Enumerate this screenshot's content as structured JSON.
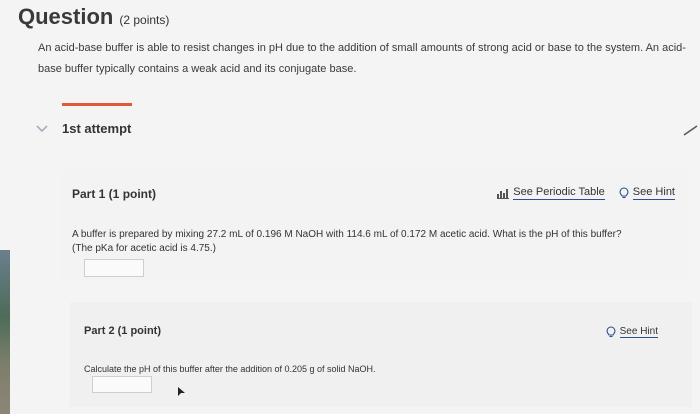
{
  "question": {
    "title": "Question",
    "points": "(2 points)",
    "intro": "An acid-base buffer is able to resist changes in pH due to the addition of small amounts of strong acid or base to the system. An acid-base buffer typically contains a weak acid and its conjugate base."
  },
  "attempt": {
    "label": "1st attempt"
  },
  "part1": {
    "heading": "Part 1   (1 point)",
    "periodic_table_link": "See Periodic Table",
    "hint_link": "See Hint",
    "question_text": "A buffer is prepared by mixing 27.2 mL of 0.196  M NaOH with 114.6  mL of 0.172 M acetic acid. What is the pH of this buffer?",
    "pka_note": "(The pKa for acetic acid is 4.75.)"
  },
  "part2": {
    "heading": "Part 2   (1 point)",
    "hint_link": "See Hint",
    "question_text": "Calculate the pH of this buffer after the addition of 0.205  g of solid NaOH."
  }
}
